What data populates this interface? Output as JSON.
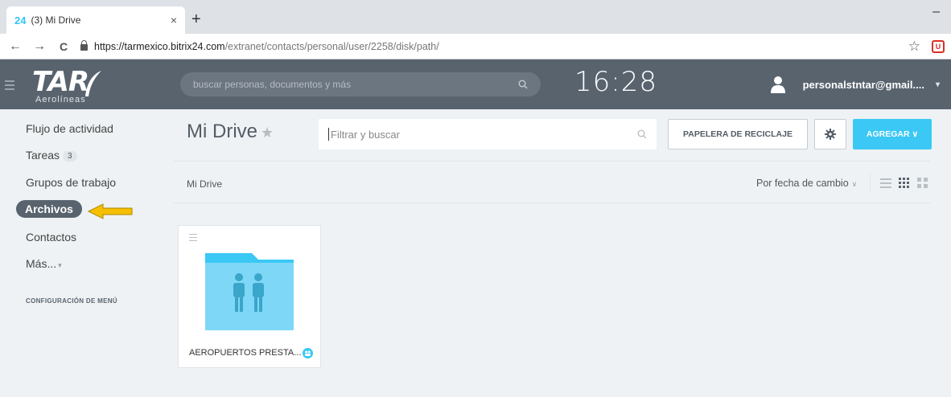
{
  "browser": {
    "tab_favicon": "24",
    "tab_title": "(3) Mi Drive",
    "tab_close": "×",
    "new_tab": "+",
    "minimize": "–",
    "back": "←",
    "forward": "→",
    "reload": "C",
    "url_host": "https://tarmexico.bitrix24.com",
    "url_path": "/extranet/contacts/personal/user/2258/disk/path/",
    "bookmark": "☆",
    "extension": "U"
  },
  "header": {
    "logo_text": "TAR",
    "logo_sub": "Aerolíneas",
    "search_placeholder": "buscar personas, documentos y más",
    "clock": "16:28",
    "user_email": "personalstntar@gmail....",
    "user_caret": "▾"
  },
  "sidebar": {
    "items": [
      {
        "label": "Flujo de actividad"
      },
      {
        "label": "Tareas",
        "badge": "3"
      },
      {
        "label": "Grupos de trabajo"
      },
      {
        "label": "Archivos",
        "active": true
      },
      {
        "label": "Contactos"
      },
      {
        "label": "Más...",
        "chevron": "▾"
      }
    ],
    "config_label": "CONFIGURACIÓN DE MENÚ"
  },
  "main": {
    "title": "Mi Drive",
    "title_star": "★",
    "filter_placeholder": "Filtrar y buscar",
    "trash_button": "PAPELERA DE RECICLAJE",
    "add_button": "AGREGAR ∨",
    "breadcrumb": "Mi Drive",
    "sort_label": "Por fecha de cambio",
    "sort_chevron": "∨",
    "items": [
      {
        "name": "AEROPUERTOS PRESTA...",
        "type": "shared-folder"
      }
    ]
  },
  "colors": {
    "header_bg": "#58636e",
    "accent": "#3bc8f5",
    "folder": "#7fd7f7",
    "folder_tab": "#3bc8f5",
    "arrow": "#f5c000"
  }
}
